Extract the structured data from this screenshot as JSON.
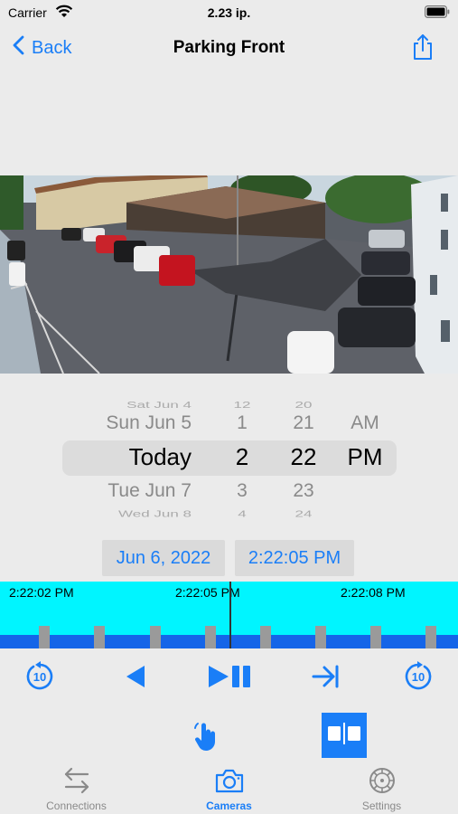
{
  "status_bar": {
    "carrier": "Carrier",
    "time": "2.23 ip.",
    "icons": [
      "wifi-icon",
      "battery-icon"
    ]
  },
  "nav": {
    "back_label": "Back",
    "title": "Parking Front",
    "share_icon": "share-icon"
  },
  "camera": {
    "scene": "parking-lot-camera-feed"
  },
  "picker": {
    "rows": [
      {
        "date": "Sat Jun 4",
        "hour": "12",
        "minute": "20",
        "ampm": ""
      },
      {
        "date": "Sun Jun 5",
        "hour": "1",
        "minute": "21",
        "ampm": "AM"
      },
      {
        "date": "Today",
        "hour": "2",
        "minute": "22",
        "ampm": "PM"
      },
      {
        "date": "Tue Jun 7",
        "hour": "3",
        "minute": "23",
        "ampm": ""
      },
      {
        "date": "Wed Jun 8",
        "hour": "4",
        "minute": "24",
        "ampm": ""
      }
    ]
  },
  "selection": {
    "date": "Jun 6, 2022",
    "time": "2:22:05 PM"
  },
  "timeline": {
    "labels": [
      "2:22:02 PM",
      "2:22:05 PM",
      "2:22:08 PM"
    ],
    "colors": {
      "background": "#00f5ff",
      "track": "#1565e8",
      "tick": "#9a9a9a"
    }
  },
  "controls": {
    "items": [
      "replay-10-icon",
      "step-back-icon",
      "play-pause-icon",
      "skip-to-end-icon",
      "forward-10-icon"
    ]
  },
  "tools": {
    "items": [
      "hand-pointer-icon",
      "split-view-icon"
    ]
  },
  "tabs": [
    {
      "label": "Connections",
      "icon": "arrows-exchange-icon",
      "active": false
    },
    {
      "label": "Cameras",
      "icon": "camera-icon",
      "active": true
    },
    {
      "label": "Settings",
      "icon": "gear-icon",
      "active": false
    }
  ],
  "colors": {
    "accent": "#1a7ef7",
    "background": "#ebebeb"
  }
}
